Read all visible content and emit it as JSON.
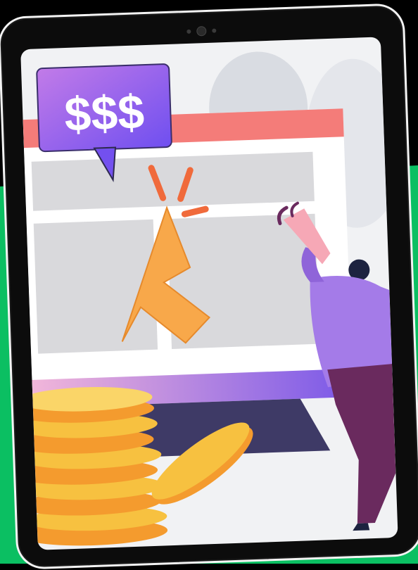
{
  "illustration": {
    "price_tag_text": "$$$"
  },
  "colors": {
    "brand_green": "#0bbf62",
    "screen_bg": "#f1f2f4",
    "bubble_purple": "#8a5bf0",
    "bar_coral": "#f47c79",
    "cursor_orange": "#f8a84a",
    "coin_gold": "#f7c140",
    "person_purple": "#a47be8",
    "pants_plum": "#6a2a5e"
  },
  "icons": [
    "price-bubble-icon",
    "click-cursor-icon",
    "megaphone-icon",
    "coin-stack-icon"
  ]
}
